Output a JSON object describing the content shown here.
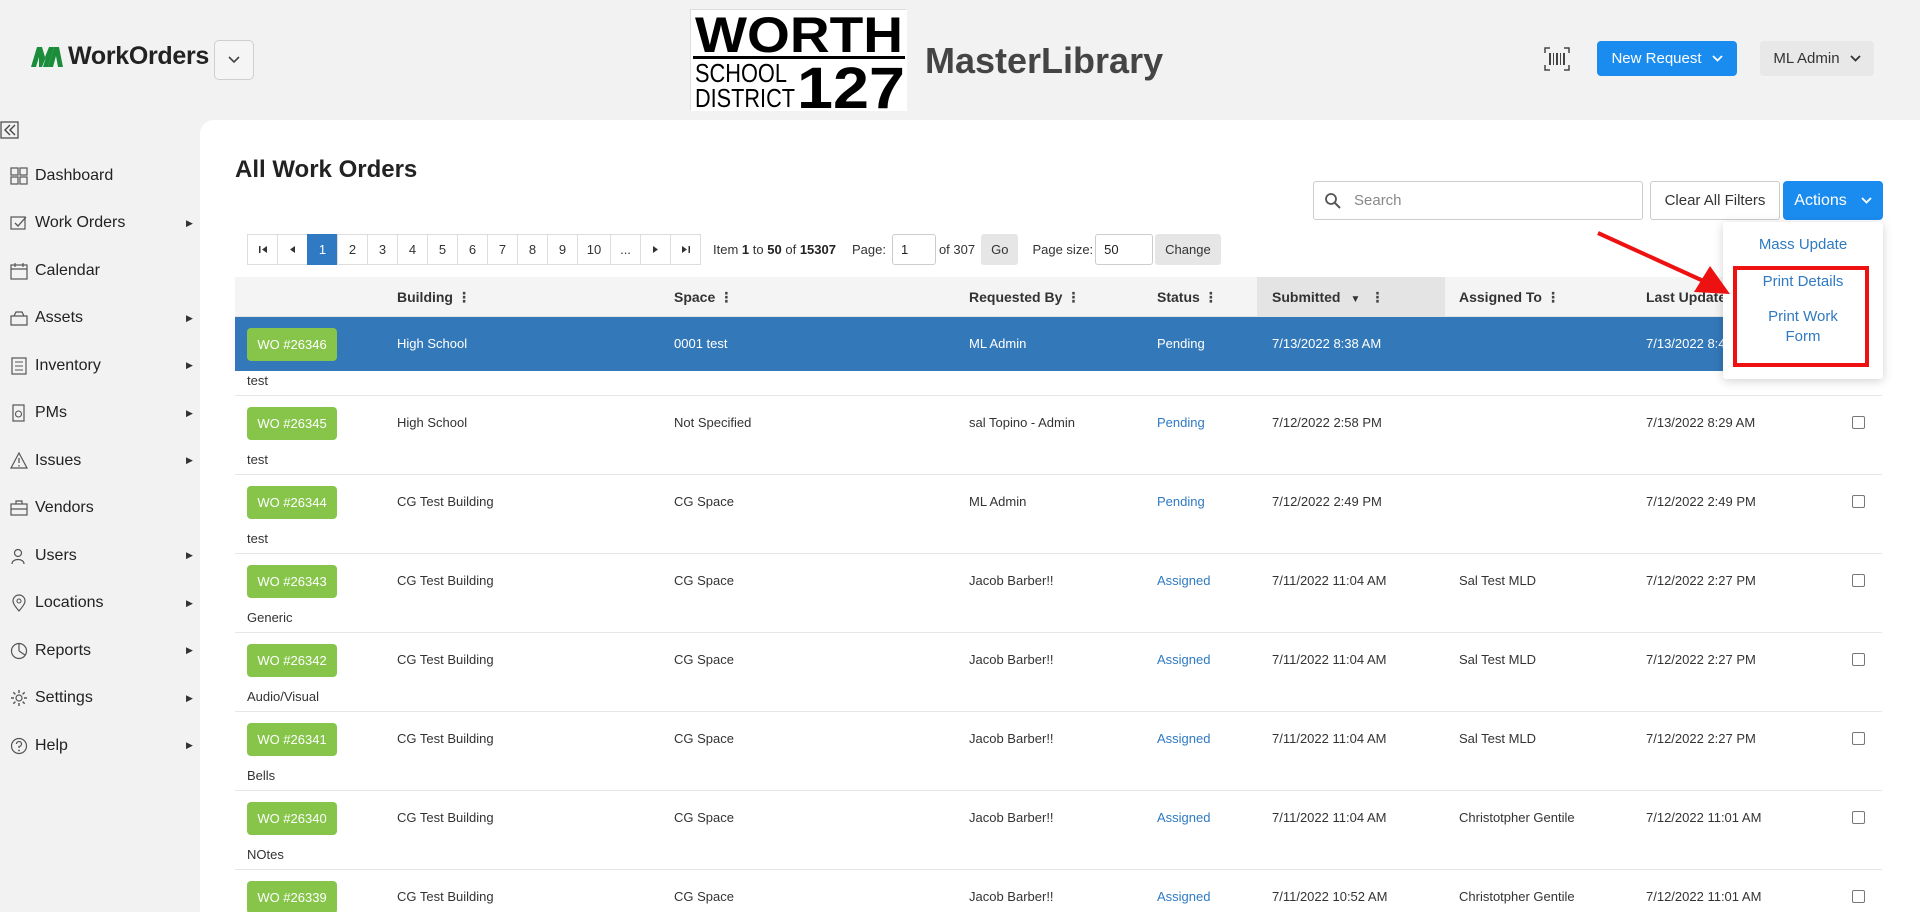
{
  "header": {
    "brand": "WorkOrders",
    "logo": {
      "line1": "WORTH",
      "line2": "SCHOOL",
      "line3": "DISTRICT",
      "number": "127"
    },
    "district_title": "MasterLibrary",
    "new_request": "New Request",
    "user": "ML Admin"
  },
  "sidebar": {
    "items": [
      {
        "label": "Dashboard",
        "icon": "dashboard-icon",
        "arrow": false
      },
      {
        "label": "Work Orders",
        "icon": "work-orders-icon",
        "arrow": true
      },
      {
        "label": "Calendar",
        "icon": "calendar-icon",
        "arrow": false
      },
      {
        "label": "Assets",
        "icon": "assets-icon",
        "arrow": true
      },
      {
        "label": "Inventory",
        "icon": "inventory-icon",
        "arrow": true
      },
      {
        "label": "PMs",
        "icon": "pms-icon",
        "arrow": true
      },
      {
        "label": "Issues",
        "icon": "warning-icon",
        "arrow": true
      },
      {
        "label": "Vendors",
        "icon": "vendors-icon",
        "arrow": false
      },
      {
        "label": "Users",
        "icon": "users-icon",
        "arrow": true
      },
      {
        "label": "Locations",
        "icon": "location-pin-icon",
        "arrow": true
      },
      {
        "label": "Reports",
        "icon": "reports-icon",
        "arrow": true
      },
      {
        "label": "Settings",
        "icon": "gear-icon",
        "arrow": true
      },
      {
        "label": "Help",
        "icon": "help-icon",
        "arrow": true
      }
    ]
  },
  "main": {
    "title": "All Work Orders",
    "search_placeholder": "Search",
    "clear_filters": "Clear All Filters",
    "actions": "Actions",
    "actions_menu": [
      "Mass Update",
      "Print Details",
      "Print Work",
      "Form"
    ]
  },
  "pager": {
    "pages": [
      "1",
      "2",
      "3",
      "4",
      "5",
      "6",
      "7",
      "8",
      "9",
      "10",
      "..."
    ],
    "first": "⏮",
    "prev": "◀",
    "next": "▶",
    "last": "⏭",
    "item_label": "Item",
    "range_from": "1",
    "to_label": "to",
    "range_to": "50",
    "of_label": "of",
    "total": "15307",
    "page_label": "Page:",
    "page_value": "1",
    "of_pages": "of 307",
    "go": "Go",
    "size_label": "Page size:",
    "size_value": "50",
    "change": "Change"
  },
  "table": {
    "columns": {
      "building": "Building",
      "space": "Space",
      "requested_by": "Requested By",
      "status": "Status",
      "submitted": "Submitted",
      "assigned_to": "Assigned To",
      "last_updated": "Last Updated"
    },
    "rows": [
      {
        "wo": "WO #26346",
        "building": "High School",
        "space": "0001 test",
        "requested_by": "ML Admin",
        "status": "Pending",
        "submitted": "7/13/2022 8:38 AM",
        "assigned_to": "",
        "last_updated": "7/13/2022 8:4",
        "desc": "test",
        "selected": true
      },
      {
        "wo": "WO #26345",
        "building": "High School",
        "space": "Not Specified",
        "requested_by": "sal Topino - Admin",
        "status": "Pending",
        "submitted": "7/12/2022 2:58 PM",
        "assigned_to": "",
        "last_updated": "7/13/2022 8:29 AM",
        "desc": "test"
      },
      {
        "wo": "WO #26344",
        "building": "CG Test Building",
        "space": "CG Space",
        "requested_by": "ML Admin",
        "status": "Pending",
        "submitted": "7/12/2022 2:49 PM",
        "assigned_to": "",
        "last_updated": "7/12/2022 2:49 PM",
        "desc": "test"
      },
      {
        "wo": "WO #26343",
        "building": "CG Test Building",
        "space": "CG Space",
        "requested_by": "Jacob Barber!!",
        "status": "Assigned",
        "submitted": "7/11/2022 11:04 AM",
        "assigned_to": "Sal Test MLD",
        "last_updated": "7/12/2022 2:27 PM",
        "desc": "Generic"
      },
      {
        "wo": "WO #26342",
        "building": "CG Test Building",
        "space": "CG Space",
        "requested_by": "Jacob Barber!!",
        "status": "Assigned",
        "submitted": "7/11/2022 11:04 AM",
        "assigned_to": "Sal Test MLD",
        "last_updated": "7/12/2022 2:27 PM",
        "desc": "Audio/Visual"
      },
      {
        "wo": "WO #26341",
        "building": "CG Test Building",
        "space": "CG Space",
        "requested_by": "Jacob Barber!!",
        "status": "Assigned",
        "submitted": "7/11/2022 11:04 AM",
        "assigned_to": "Sal Test MLD",
        "last_updated": "7/12/2022 2:27 PM",
        "desc": "Bells"
      },
      {
        "wo": "WO #26340",
        "building": "CG Test Building",
        "space": "CG Space",
        "requested_by": "Jacob Barber!!",
        "status": "Assigned",
        "submitted": "7/11/2022 11:04 AM",
        "assigned_to": "Christotpher Gentile",
        "last_updated": "7/12/2022 11:01 AM",
        "desc": "NOtes"
      },
      {
        "wo": "WO #26339",
        "building": "CG Test Building",
        "space": "CG Space",
        "requested_by": "Jacob Barber!!",
        "status": "Assigned",
        "submitted": "7/11/2022 10:52 AM",
        "assigned_to": "Christotpher Gentile",
        "last_updated": "7/12/2022 11:01 AM",
        "desc": ""
      }
    ]
  },
  "colors": {
    "accent": "#1a8cf0",
    "selected_row": "#3378b8",
    "wo_badge": "#86c549",
    "highlight": "#ee1111"
  }
}
